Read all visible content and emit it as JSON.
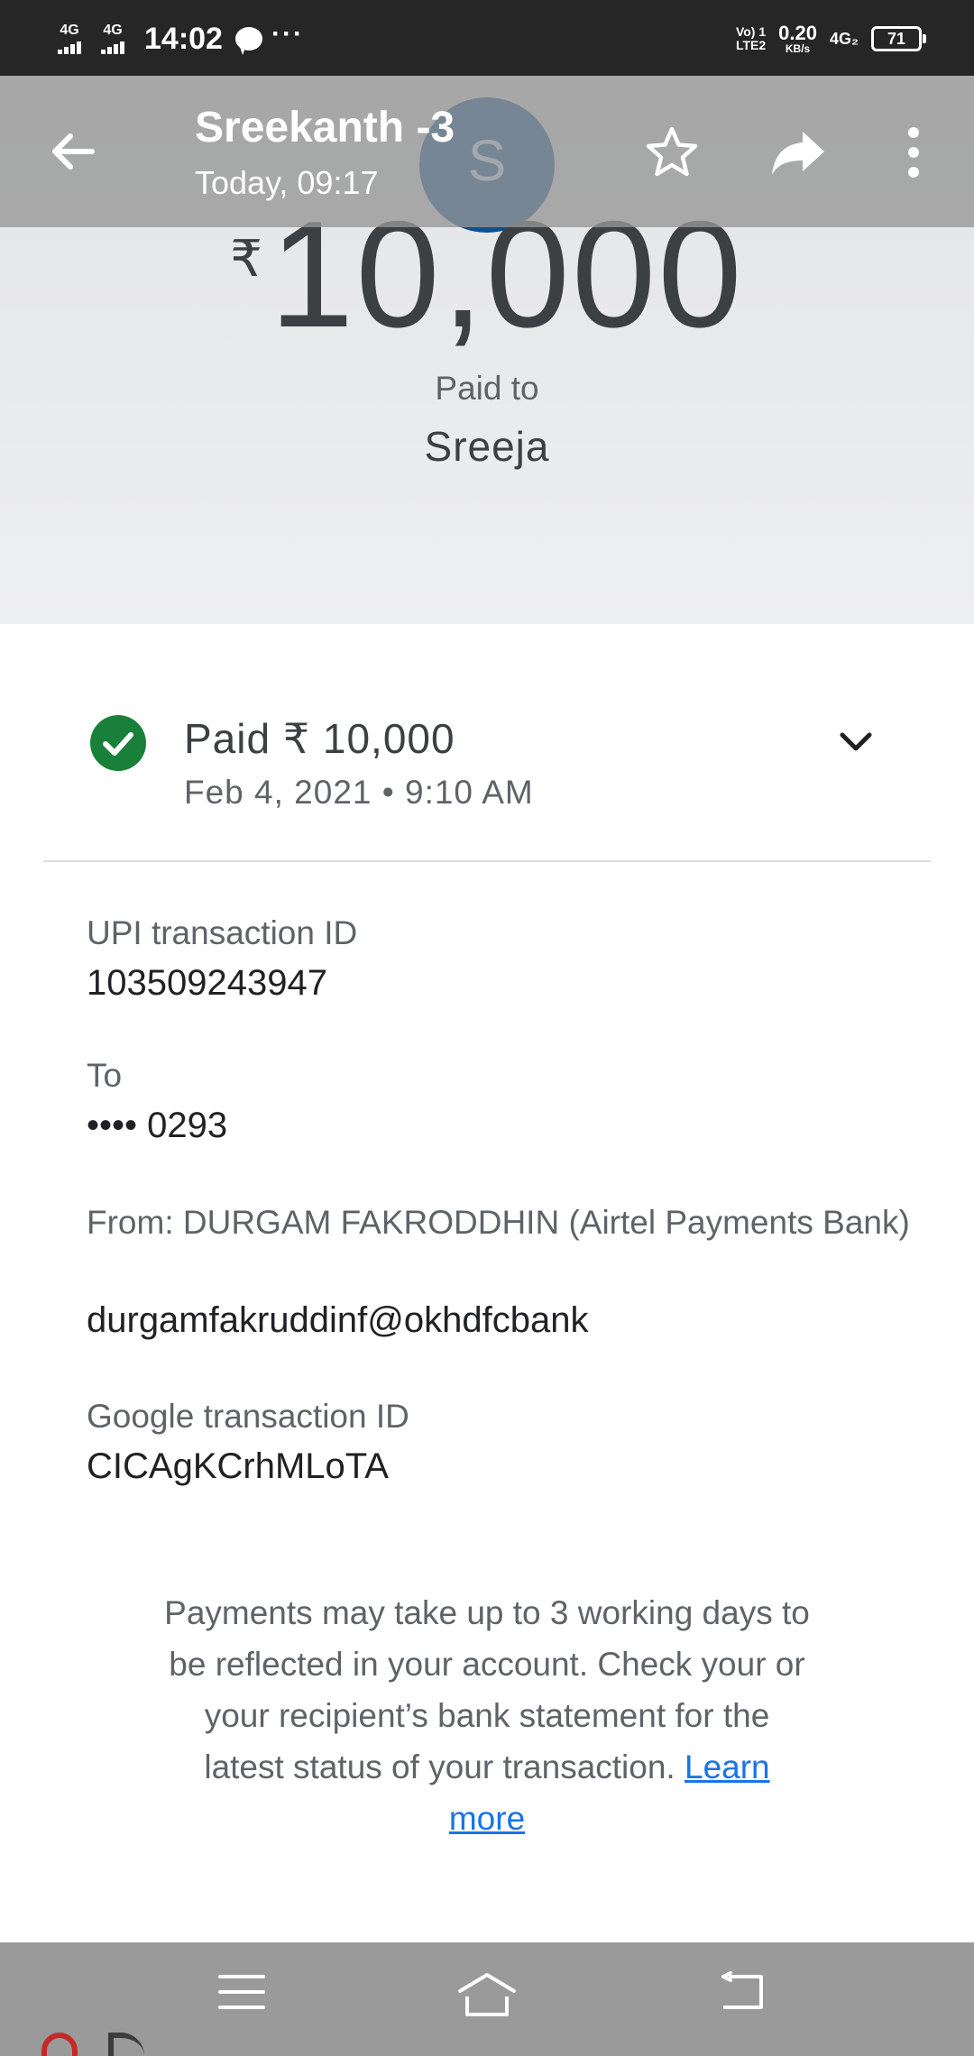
{
  "status_bar": {
    "sim1": "4G",
    "sim2": "4G",
    "time": "14:02",
    "volte_top": "Vo) 1",
    "volte_bottom": "LTE2",
    "speed_value": "0.20",
    "speed_unit": "KB/s",
    "net_type": "4G₂",
    "battery": "71"
  },
  "toolbar": {
    "title": "Sreekanth -3",
    "subtitle": "Today, 09:17"
  },
  "avatar": {
    "letter": "S",
    "color": "#0d4f91"
  },
  "hero": {
    "currency": "₹",
    "amount": "10,000",
    "paid_to_label": "Paid to",
    "payee": "Sreeja"
  },
  "status": {
    "title": "Paid ₹ 10,000",
    "date": "Feb 4, 2021 • 9:10 AM",
    "color": "#188038"
  },
  "details": {
    "upi_label": "UPI transaction ID",
    "upi_value": "103509243947",
    "to_label": "To",
    "to_value": "•••• 0293",
    "from_label": "From: DURGAM  FAKRODDHIN (Airtel Payments Bank)",
    "from_value": "durgamfakruddinf@okhdfcbank",
    "google_label": "Google transaction ID",
    "google_value": "CICAgKCrhMLoTA"
  },
  "note": {
    "text": "Payments may take up to 3 working days to be reflected in your account. Check your or your recipient’s bank statement for the latest status of your transaction.",
    "link": "Learn more"
  }
}
